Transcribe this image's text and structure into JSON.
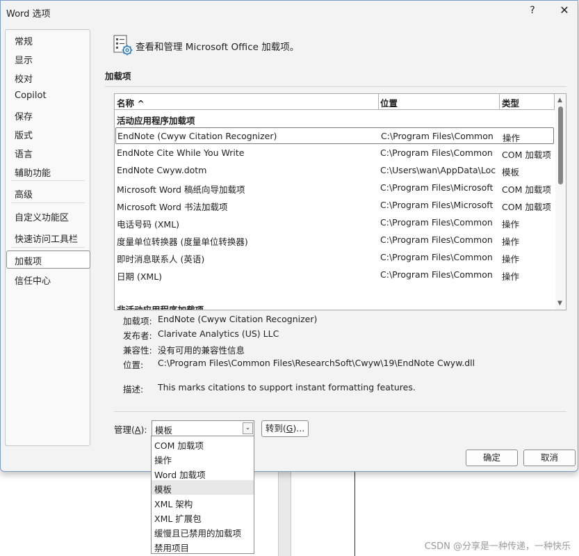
{
  "window": {
    "title": "Word 选项",
    "help_glyph": "?",
    "close_glyph": "✕"
  },
  "nav": {
    "items": [
      {
        "label": "常规"
      },
      {
        "label": "显示"
      },
      {
        "label": "校对"
      },
      {
        "label": "Copilot"
      },
      {
        "label": "保存"
      },
      {
        "label": "版式"
      },
      {
        "label": "语言"
      },
      {
        "label": "辅助功能"
      },
      {
        "label": "高级"
      },
      {
        "label": "自定义功能区"
      },
      {
        "label": "快速访问工具栏"
      },
      {
        "label": "加载项",
        "selected": true
      },
      {
        "label": "信任中心"
      }
    ]
  },
  "header": {
    "text": "查看和管理 Microsoft Office 加载项。"
  },
  "section": {
    "title": "加载项"
  },
  "table": {
    "columns": {
      "name": "名称 ^",
      "location": "位置",
      "type": "类型"
    },
    "active_group": "活动应用程序加载项",
    "inactive_group": "非活动应用程序加载项",
    "rows": [
      {
        "name": "EndNote (Cwyw Citation Recognizer)",
        "location": "C:\\Program Files\\Common",
        "type": "操作"
      },
      {
        "name": "EndNote Cite While You Write",
        "location": "C:\\Program Files\\Common",
        "type": "COM 加载项"
      },
      {
        "name": "EndNote Cwyw.dotm",
        "location": "C:\\Users\\wan\\AppData\\Loc",
        "type": "模板"
      },
      {
        "name": "Microsoft Word 稿纸向导加载项",
        "location": "C:\\Program Files\\Microsoft",
        "type": "COM 加载项"
      },
      {
        "name": "Microsoft Word 书法加载项",
        "location": "C:\\Program Files\\Microsoft",
        "type": "COM 加载项"
      },
      {
        "name": "电话号码 (XML)",
        "location": "C:\\Program Files\\Common",
        "type": "操作"
      },
      {
        "name": "度量单位转换器 (度量单位转换器)",
        "location": "C:\\Program Files\\Common",
        "type": "操作"
      },
      {
        "name": "即时消息联系人 (英语)",
        "location": "C:\\Program Files\\Common",
        "type": "操作"
      },
      {
        "name": "日期 (XML)",
        "location": "C:\\Program Files\\Common",
        "type": "操作"
      }
    ],
    "scroll_up_glyph": "▲",
    "scroll_down_glyph": "▼"
  },
  "details": {
    "addin_label": "加载项:",
    "addin_value": "EndNote (Cwyw Citation Recognizer)",
    "publisher_label": "发布者:",
    "publisher_value": "Clarivate Analytics (US) LLC",
    "compat_label": "兼容性:",
    "compat_value": "没有可用的兼容性信息",
    "location_label": "位置:",
    "location_value": "C:\\Program Files\\Common Files\\ResearchSoft\\Cwyw\\19\\EndNote Cwyw.dll",
    "desc_label": "描述:",
    "desc_value": "This marks citations to support instant formatting features."
  },
  "manage": {
    "label_prefix": "管理(",
    "label_key": "A",
    "label_suffix": "):",
    "selected": "模板",
    "arrow_glyph": "⌄",
    "goto_prefix": "转到(",
    "goto_key": "G",
    "goto_suffix": ")...",
    "options": [
      "COM 加载项",
      "操作",
      "Word 加载项",
      "模板",
      "XML 架构",
      "XML 扩展包",
      "缓慢且已禁用的加载项",
      "禁用项目"
    ],
    "highlighted_index": 3
  },
  "buttons": {
    "ok": "确定",
    "cancel": "取消"
  },
  "watermark": "CSDN @分享是一种传递，一种快乐"
}
